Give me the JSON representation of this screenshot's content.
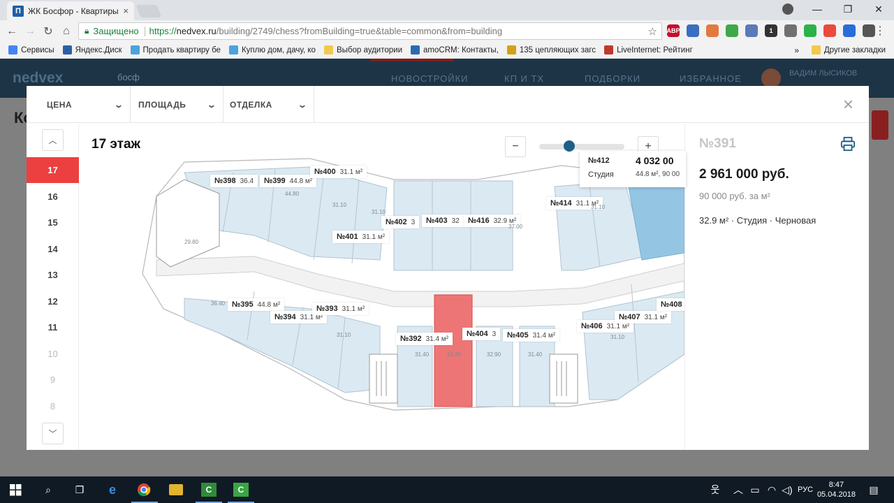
{
  "browser": {
    "tab_title": "ЖК Босфор - Квартиры",
    "tab_favicon": "П",
    "tab_close": "×",
    "secure_label": "Защищено",
    "url_scheme": "https://",
    "url_host": "nedvex.ru",
    "url_path": "/building/2749/chess?fromBuilding=true&table=common&from=building",
    "window_controls": [
      "—",
      "❐",
      "✕"
    ],
    "extensions": [
      {
        "label": "ABP",
        "color": "#c70d2c"
      },
      {
        "label": "",
        "color": "#3b6ec0"
      },
      {
        "label": "",
        "color": "#e27a3f"
      },
      {
        "label": "",
        "color": "#3fa84a"
      },
      {
        "label": "",
        "color": "#5a7ab8"
      },
      {
        "label": "1",
        "color": "#333333"
      },
      {
        "label": "",
        "color": "#707070"
      },
      {
        "label": "",
        "color": "#2db24a"
      },
      {
        "label": "",
        "color": "#ea4b3c"
      },
      {
        "label": "",
        "color": "#2a6dd9"
      },
      {
        "label": "",
        "color": "#555555"
      }
    ]
  },
  "bookmarks": {
    "items": [
      {
        "label": "Сервисы",
        "color": "#4285f4"
      },
      {
        "label": "Яндекс.Диск",
        "color": "#2d5fa6"
      },
      {
        "label": "Продать квартиру бе",
        "color": "#4aa3df"
      },
      {
        "label": "Куплю дом, дачу, ко",
        "color": "#4aa3df"
      },
      {
        "label": "Выбор аудитории",
        "color": "#f2c94c"
      },
      {
        "label": "amoCRM: Контакты,",
        "color": "#2b6cb0"
      },
      {
        "label": "135 цепляющих загс",
        "color": "#d4a017"
      },
      {
        "label": "LiveInternet: Рейтинг",
        "color": "#c0392b"
      }
    ],
    "more": "»",
    "other": "Другие закладки"
  },
  "site": {
    "logo": "nedvex",
    "search": "босф",
    "nav": [
      "НОВОСТРОЙКИ",
      "КП И ТХ",
      "ПОДБОРКИ",
      "ИЗБРАННОЕ"
    ],
    "user_name": "ВАДИМ ЛЫСИКОВ",
    "heading": "Ко"
  },
  "modal": {
    "filters": [
      {
        "label": "ЦЕНА"
      },
      {
        "label": "ПЛОЩАДЬ"
      },
      {
        "label": "ОТДЕЛКА"
      }
    ],
    "close": "×",
    "floor_up": "︿",
    "floor_down": "﹀",
    "floors": [
      {
        "num": "17",
        "state": "active"
      },
      {
        "num": "16",
        "state": "normal"
      },
      {
        "num": "15",
        "state": "normal"
      },
      {
        "num": "14",
        "state": "normal"
      },
      {
        "num": "13",
        "state": "normal"
      },
      {
        "num": "12",
        "state": "normal"
      },
      {
        "num": "11",
        "state": "normal"
      },
      {
        "num": "10",
        "state": "dim"
      },
      {
        "num": "9",
        "state": "dim"
      },
      {
        "num": "8",
        "state": "dim"
      }
    ],
    "plan_title": "17 этаж",
    "zoom_minus": "−",
    "zoom_plus": "+",
    "zoom_level": 0.35,
    "selected": {
      "number": "№391",
      "price": "2 961 000 руб.",
      "price_per_m2": "90 000 руб. за м²",
      "description": "32.9 м² · Студия · Черновая"
    },
    "tooltip": {
      "number": "№412",
      "price": "4 032 00",
      "type": "Студия",
      "area_price": "44.8 м², 90 00"
    },
    "units": [
      {
        "num": "№398",
        "area": "36.4"
      },
      {
        "num": "№399",
        "area": "44.8 м²"
      },
      {
        "num": "№400",
        "area": "31.1 м²"
      },
      {
        "num": "№401",
        "area": "31.1 м²"
      },
      {
        "num": "№402",
        "area": "3"
      },
      {
        "num": "№403",
        "area": "32"
      },
      {
        "num": "№416",
        "area": "32.9 м²"
      },
      {
        "num": "№414",
        "area": "31.1 м²"
      },
      {
        "num": "№395",
        "area": "44.8 м²"
      },
      {
        "num": "№394",
        "area": "31.1 м²"
      },
      {
        "num": "№393",
        "area": "31.1 м²"
      },
      {
        "num": "№392",
        "area": "31.4 м²"
      },
      {
        "num": "№404",
        "area": "3"
      },
      {
        "num": "№405",
        "area": "31.4 м²"
      },
      {
        "num": "№406",
        "area": "31.1 м²"
      },
      {
        "num": "№407",
        "area": "31.1 м²"
      },
      {
        "num": "№408",
        "area": ""
      }
    ],
    "room_areas": [
      "29.80",
      "44.80",
      "31.10",
      "31.10",
      "37.00",
      "31.10",
      "36.40",
      "31.10",
      "31.40",
      "32.80",
      "32.90",
      "31.40",
      "31.10"
    ]
  },
  "taskbar": {
    "time": "8:47",
    "date": "05.04.2018",
    "lang": "РУС"
  }
}
